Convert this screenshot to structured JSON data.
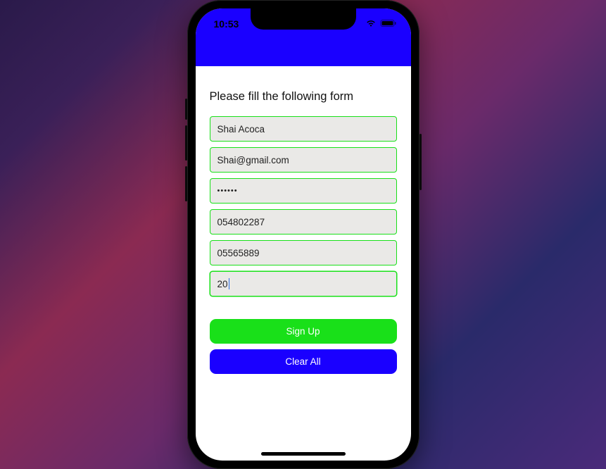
{
  "status": {
    "time": "10:53"
  },
  "form": {
    "heading": "Please fill the following form",
    "name": "Shai Acoca",
    "email": "Shai@gmail.com",
    "password_masked": "••••••",
    "phone1": "054802287",
    "phone2": "05565889",
    "age": "20"
  },
  "buttons": {
    "signup": "Sign Up",
    "clear": "Clear All"
  },
  "colors": {
    "accent_blue": "#1a00ff",
    "accent_green": "#19e019",
    "field_bg": "#eae9e7"
  }
}
